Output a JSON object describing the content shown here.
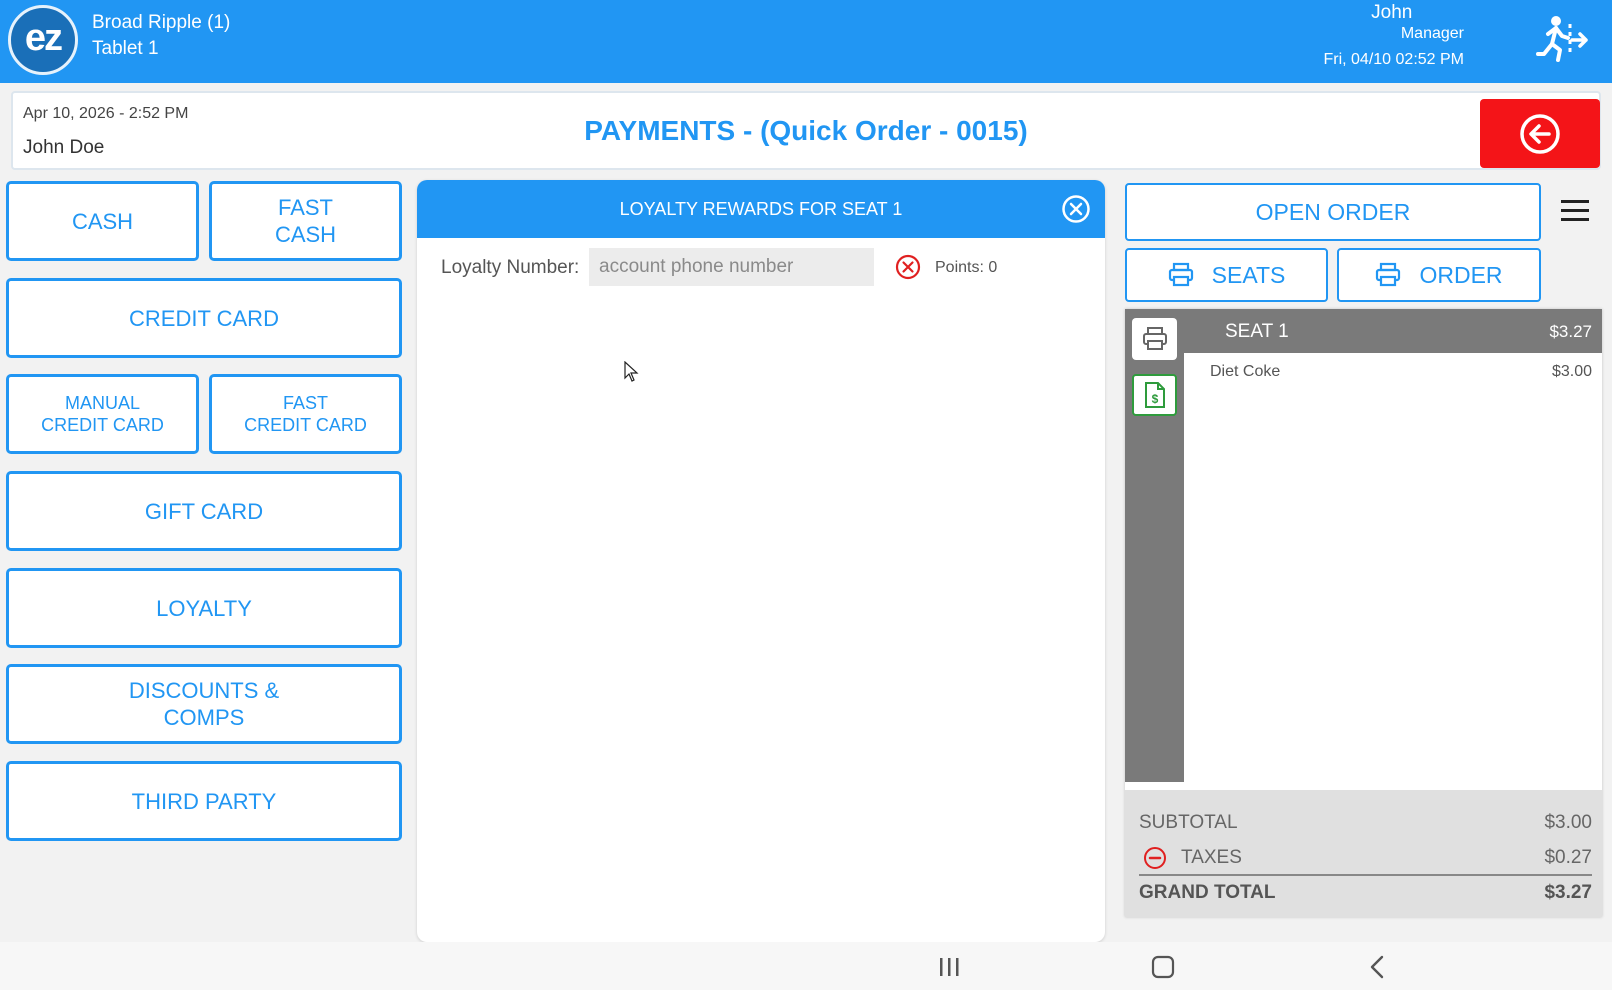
{
  "topbar": {
    "logo_text": "ez",
    "location": "Broad Ripple (1)",
    "device": "Tablet 1",
    "user_name": "John",
    "user_role": "Manager",
    "datetime": "Fri, 04/10 02:52 PM",
    "logout_icon": "logout-running-man-icon"
  },
  "header": {
    "date": "Apr 10, 2026  - 2:52 PM",
    "customer": "John Doe",
    "title": "PAYMENTS - (Quick Order - 0015)",
    "back_icon": "back-arrow-icon"
  },
  "payment_buttons": {
    "cash": "CASH",
    "fast_cash": "FAST\nCASH",
    "credit_card": "CREDIT CARD",
    "manual_credit_card": "MANUAL\nCREDIT CARD",
    "fast_credit_card": "FAST\nCREDIT CARD",
    "gift_card": "GIFT CARD",
    "loyalty": "LOYALTY",
    "discounts_comps": "DISCOUNTS &\nCOMPS",
    "third_party": "THIRD PARTY"
  },
  "loyalty_panel": {
    "title": "LOYALTY REWARDS FOR SEAT 1",
    "number_label": "Loyalty Number:",
    "number_value": "",
    "number_placeholder": "account phone number",
    "points": "Points: 0"
  },
  "order_panel": {
    "open_order": "OPEN ORDER",
    "seats": "SEATS",
    "order": "ORDER",
    "seat": {
      "name": "SEAT 1",
      "total": "$3.27",
      "items": [
        {
          "name": "Diet Coke",
          "price": "$3.00"
        }
      ]
    },
    "totals": {
      "subtotal_label": "SUBTOTAL",
      "subtotal_value": "$3.00",
      "taxes_label": "TAXES",
      "taxes_value": "$0.27",
      "grand_label": "GRAND TOTAL",
      "grand_value": "$3.27"
    }
  },
  "colors": {
    "primary": "#2196f3",
    "danger": "#f41418",
    "rail_gray": "#7a7a7a",
    "receipt_green": "#2e9b3c"
  }
}
